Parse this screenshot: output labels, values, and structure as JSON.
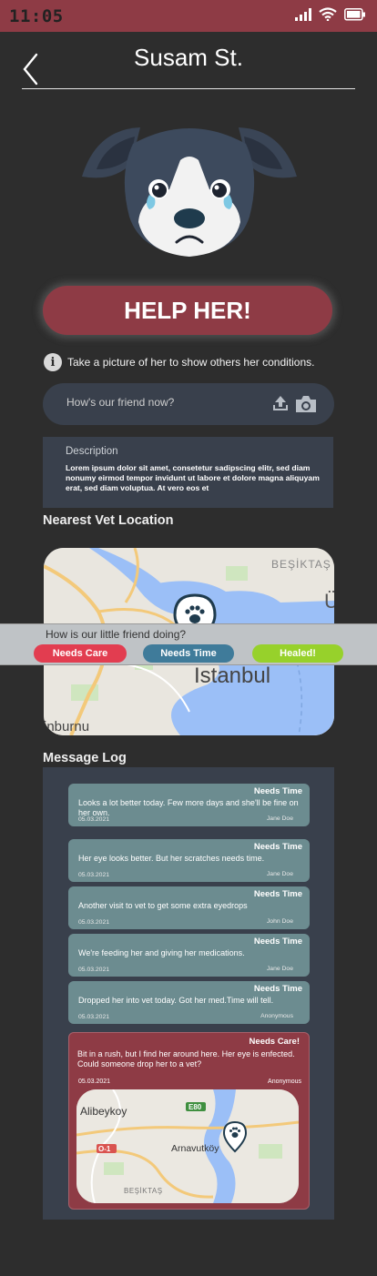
{
  "status_bar": {
    "time": "11:05"
  },
  "header": {
    "title": "Susam St."
  },
  "help_button": {
    "label": "HELP HER!"
  },
  "info": {
    "text": "Take a picture of her to show others her conditions."
  },
  "status_input": {
    "placeholder": "How's our friend now?"
  },
  "description": {
    "label": "Description",
    "text": "Lorem ipsum dolor sit amet, consetetur sadipscing elitr, sed diam nonumy eirmod tempor invidunt ut labore et dolore magna aliquyam erat, sed diam voluptua. At vero eos et"
  },
  "vet_section": {
    "title": "Nearest Vet Location"
  },
  "map_labels": {
    "besiktas": "BEŞİKTAŞ",
    "istanbul": "İstanbul",
    "zeytinburnu": "inburnu",
    "u": "Ü"
  },
  "prompt": {
    "question": "How is our little friend doing?",
    "options": [
      {
        "label": "Needs Care",
        "color": "#e23d50"
      },
      {
        "label": "Needs Time",
        "color": "#3f7b9a"
      },
      {
        "label": "Healed!",
        "color": "#97d12b"
      }
    ]
  },
  "log_section": {
    "title": "Message Log"
  },
  "messages": [
    {
      "tag": "Needs Time",
      "text": "Looks a lot better today. Few more days and she'll be fine on her own.",
      "date": "05.03.2021",
      "author": "Jane Doe"
    },
    {
      "tag": "Needs Time",
      "text": "Her eye looks better. But her scratches needs time.",
      "date": "05.03.2021",
      "author": "Jane Doe"
    },
    {
      "tag": "Needs Time",
      "text": "Another visit to vet to get some extra eyedrops",
      "date": "05.03.2021",
      "author": "John Doe"
    },
    {
      "tag": "Needs Time",
      "text": "We're feeding her and giving her medications.",
      "date": "05.03.2021",
      "author": "Jane Doe"
    },
    {
      "tag": "Needs Time",
      "text": "Dropped her into vet today. Got her med.Time will tell.",
      "date": "05.03.2021",
      "author": "Anonymous"
    }
  ],
  "care_message": {
    "tag": "Needs Care!",
    "text": "Bit in a rush, but I find her around here. Her eye is enfected. Could someone drop her to a vet?",
    "date": "05.03.2021",
    "author": "Anonymous",
    "map_labels": {
      "alibeykoy": "Alibeykoy",
      "e80": "E80",
      "o1": "O-1",
      "arnavutkoy": "Arnavutköy",
      "besiktas": "BEŞİKTAŞ"
    }
  },
  "colors": {
    "background": "#2d2d2d",
    "accent_red": "#8e3b45",
    "panel": "#39404c",
    "message_card": "#6c8c90",
    "needs_care": "#e23d50",
    "needs_time": "#3f7b9a",
    "healed": "#97d12b"
  },
  "icons": [
    "signal-icon",
    "wifi-icon",
    "battery-icon",
    "back-arrow-icon",
    "info-icon",
    "upload-icon",
    "camera-icon",
    "paw-pin-icon"
  ]
}
